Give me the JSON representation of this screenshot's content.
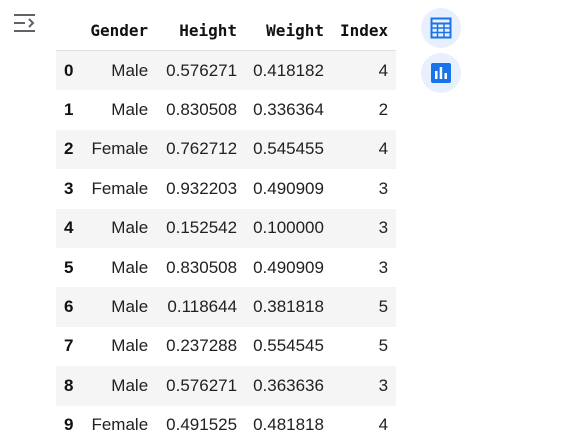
{
  "output_toggle_icon": "collapse-output-icon",
  "table": {
    "columns": [
      "Gender",
      "Height",
      "Weight",
      "Index"
    ],
    "rows": [
      {
        "index": "0",
        "gender": "Male",
        "height": "0.576271",
        "weight": "0.418182",
        "idx": "4"
      },
      {
        "index": "1",
        "gender": "Male",
        "height": "0.830508",
        "weight": "0.336364",
        "idx": "2"
      },
      {
        "index": "2",
        "gender": "Female",
        "height": "0.762712",
        "weight": "0.545455",
        "idx": "4"
      },
      {
        "index": "3",
        "gender": "Female",
        "height": "0.932203",
        "weight": "0.490909",
        "idx": "3"
      },
      {
        "index": "4",
        "gender": "Male",
        "height": "0.152542",
        "weight": "0.100000",
        "idx": "3"
      },
      {
        "index": "5",
        "gender": "Male",
        "height": "0.830508",
        "weight": "0.490909",
        "idx": "3"
      },
      {
        "index": "6",
        "gender": "Male",
        "height": "0.118644",
        "weight": "0.381818",
        "idx": "5"
      },
      {
        "index": "7",
        "gender": "Male",
        "height": "0.237288",
        "weight": "0.554545",
        "idx": "5"
      },
      {
        "index": "8",
        "gender": "Male",
        "height": "0.576271",
        "weight": "0.363636",
        "idx": "3"
      },
      {
        "index": "9",
        "gender": "Female",
        "height": "0.491525",
        "weight": "0.481818",
        "idx": "4"
      }
    ]
  },
  "side_buttons": {
    "table_icon": "interactive-table-icon",
    "chart_icon": "suggest-charts-icon"
  },
  "colors": {
    "accent": "#1a73e8",
    "button_bg": "#e8f0fe",
    "stripe": "#f5f5f5"
  }
}
